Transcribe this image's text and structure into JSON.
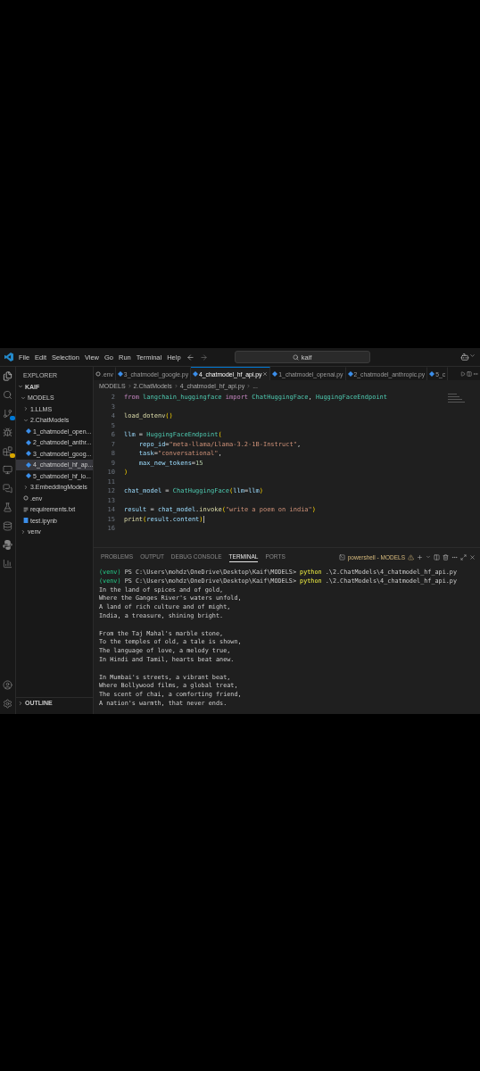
{
  "menu": [
    "File",
    "Edit",
    "Selection",
    "View",
    "Go",
    "Run",
    "Terminal",
    "Help"
  ],
  "search": {
    "value": "kaif"
  },
  "explorer": {
    "title": "EXPLORER",
    "root": "KAIF",
    "tree": [
      {
        "label": "MODELS",
        "kind": "folder",
        "expanded": true,
        "selected": false,
        "children": [
          {
            "label": "1.LLMS",
            "kind": "folder",
            "expanded": false,
            "selected": false
          },
          {
            "label": "2.ChatModels",
            "kind": "folder",
            "expanded": true,
            "selected": false,
            "children": [
              {
                "label": "1_chatmodel_open...",
                "kind": "python",
                "selected": false
              },
              {
                "label": "2_chatmodel_anthr...",
                "kind": "python",
                "selected": false
              },
              {
                "label": "3_chatmodel_goog...",
                "kind": "python",
                "selected": false
              },
              {
                "label": "4_chatmodel_hf_ap...",
                "kind": "python",
                "selected": true
              },
              {
                "label": "5_chatmodel_hf_lo...",
                "kind": "python",
                "selected": false
              }
            ]
          },
          {
            "label": "3.EmbeddingModels",
            "kind": "folder",
            "expanded": false,
            "selected": false
          },
          {
            "label": ".env",
            "kind": "env",
            "selected": false
          },
          {
            "label": "requirements.txt",
            "kind": "text",
            "selected": false
          },
          {
            "label": "test.ipynb",
            "kind": "notebook",
            "selected": false
          }
        ]
      },
      {
        "label": "venv",
        "kind": "folder",
        "expanded": false,
        "selected": false
      }
    ],
    "outline": "OUTLINE"
  },
  "tabs": [
    {
      "label": ".env",
      "kind": "env",
      "selected": false
    },
    {
      "label": "3_chatmodel_google.py",
      "kind": "python",
      "selected": false
    },
    {
      "label": "4_chatmodel_hf_api.py",
      "kind": "python",
      "selected": true
    },
    {
      "label": "1_chatmodel_openai.py",
      "kind": "python",
      "selected": false
    },
    {
      "label": "2_chatmodel_anthropic.py",
      "kind": "python",
      "selected": false
    },
    {
      "label": "5_c",
      "kind": "python",
      "selected": false
    }
  ],
  "breadcrumb": [
    "MODELS",
    "2.ChatModels",
    "4_chatmodel_hf_api.py",
    "..."
  ],
  "code": [
    {
      "number": "2",
      "tokens": [
        {
          "text": "from",
          "kind": "keyword"
        },
        {
          "text": " langchain_huggingface ",
          "kind": "class"
        },
        {
          "text": "import",
          "kind": "keyword"
        },
        {
          "text": " ChatHuggingFace",
          "kind": "class"
        },
        {
          "text": ", ",
          "kind": "plain"
        },
        {
          "text": "HuggingFaceEndpoint",
          "kind": "class"
        }
      ]
    },
    {
      "number": "3"
    },
    {
      "number": "4",
      "tokens": [
        {
          "text": "load_dotenv",
          "kind": "function"
        },
        {
          "text": "()",
          "kind": "bracket"
        }
      ]
    },
    {
      "number": "5"
    },
    {
      "number": "6",
      "tokens": [
        {
          "text": "llm",
          "kind": "variable"
        },
        {
          "text": " = ",
          "kind": "plain"
        },
        {
          "text": "HuggingFaceEndpoint",
          "kind": "class"
        },
        {
          "text": "(",
          "kind": "bracket"
        }
      ]
    },
    {
      "number": "7",
      "tokens": [
        {
          "text": "    repo_id",
          "kind": "variable"
        },
        {
          "text": "=",
          "kind": "plain"
        },
        {
          "text": "\"meta-llama/Llama-3.2-1B-Instruct\"",
          "kind": "string"
        },
        {
          "text": ",",
          "kind": "plain"
        }
      ]
    },
    {
      "number": "8",
      "tokens": [
        {
          "text": "    task",
          "kind": "variable"
        },
        {
          "text": "=",
          "kind": "plain"
        },
        {
          "text": "\"conversational\"",
          "kind": "string"
        },
        {
          "text": ",",
          "kind": "plain"
        }
      ]
    },
    {
      "number": "9",
      "tokens": [
        {
          "text": "    max_new_tokens",
          "kind": "variable"
        },
        {
          "text": "=",
          "kind": "plain"
        },
        {
          "text": "15",
          "kind": "number"
        }
      ]
    },
    {
      "number": "10",
      "tokens": [
        {
          "text": ")",
          "kind": "bracket"
        }
      ]
    },
    {
      "number": "11"
    },
    {
      "number": "12",
      "tokens": [
        {
          "text": "chat_model",
          "kind": "variable"
        },
        {
          "text": " = ",
          "kind": "plain"
        },
        {
          "text": "ChatHuggingFace",
          "kind": "class"
        },
        {
          "text": "(",
          "kind": "bracket"
        },
        {
          "text": "llm",
          "kind": "variable"
        },
        {
          "text": "=",
          "kind": "plain"
        },
        {
          "text": "llm",
          "kind": "variable"
        },
        {
          "text": ")",
          "kind": "bracket"
        }
      ]
    },
    {
      "number": "13"
    },
    {
      "number": "14",
      "tokens": [
        {
          "text": "result",
          "kind": "variable"
        },
        {
          "text": " = ",
          "kind": "plain"
        },
        {
          "text": "chat_model",
          "kind": "variable"
        },
        {
          "text": ".",
          "kind": "plain"
        },
        {
          "text": "invoke",
          "kind": "function"
        },
        {
          "text": "(",
          "kind": "bracket"
        },
        {
          "text": "\"write a poem on india\"",
          "kind": "string"
        },
        {
          "text": ")",
          "kind": "bracket"
        }
      ]
    },
    {
      "number": "15",
      "cursor": true,
      "tokens": [
        {
          "text": "print",
          "kind": "function"
        },
        {
          "text": "(",
          "kind": "bracket"
        },
        {
          "text": "result",
          "kind": "variable"
        },
        {
          "text": ".",
          "kind": "plain"
        },
        {
          "text": "content",
          "kind": "variable"
        },
        {
          "text": ")",
          "kind": "bracket"
        }
      ]
    },
    {
      "number": "16"
    }
  ],
  "panel": {
    "tabs": [
      {
        "label": "PROBLEMS",
        "selected": false
      },
      {
        "label": "OUTPUT",
        "selected": false
      },
      {
        "label": "DEBUG CONSOLE",
        "selected": false
      },
      {
        "label": "TERMINAL",
        "selected": true
      },
      {
        "label": "PORTS",
        "selected": false
      }
    ],
    "terminal_name": "powershell - MODELS",
    "lines": [
      {
        "kind": "command",
        "env": "(venv)",
        "prompt": " PS C:\\Users\\mohdz\\OneDrive\\Desktop\\Kaif\\MODELS> ",
        "program": "python",
        "args": " .\\2.ChatModels\\4_chatmodel_hf_api.py"
      },
      {
        "kind": "command",
        "env": "(venv)",
        "prompt": " PS C:\\Users\\mohdz\\OneDrive\\Desktop\\Kaif\\MODELS> ",
        "program": "python",
        "args": " .\\2.ChatModels\\4_chatmodel_hf_api.py"
      },
      {
        "kind": "output",
        "text": "In the land of spices and of gold,"
      },
      {
        "kind": "output",
        "text": "Where the Ganges River's waters unfold,"
      },
      {
        "kind": "output",
        "text": "A land of rich culture and of might,"
      },
      {
        "kind": "output",
        "text": "India, a treasure, shining bright."
      },
      {
        "kind": "blank"
      },
      {
        "kind": "output",
        "text": "From the Taj Mahal's marble stone,"
      },
      {
        "kind": "output",
        "text": "To the temples of old, a tale is shown,"
      },
      {
        "kind": "output",
        "text": "The language of love, a melody true,"
      },
      {
        "kind": "output",
        "text": "In Hindi and Tamil, hearts beat anew."
      },
      {
        "kind": "blank"
      },
      {
        "kind": "output",
        "text": "In Mumbai's streets, a vibrant beat,"
      },
      {
        "kind": "output",
        "text": "Where Bollywood films, a global treat,"
      },
      {
        "kind": "output",
        "text": "The scent of chai, a comforting friend,"
      },
      {
        "kind": "output",
        "text": "A nation's warmth, that never ends."
      }
    ]
  }
}
